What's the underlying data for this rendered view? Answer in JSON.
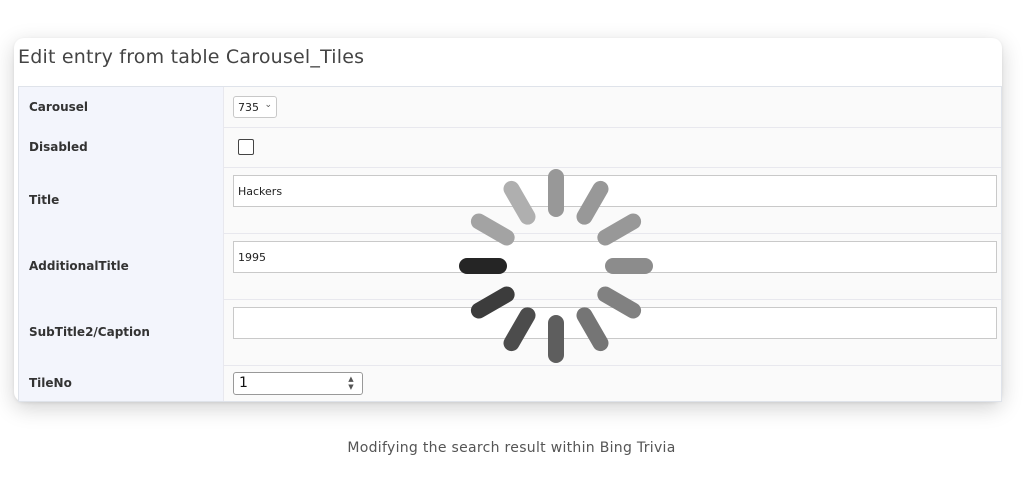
{
  "heading": "Edit entry from table Carousel_Tiles",
  "fields": {
    "carousel": {
      "label": "Carousel",
      "value": "735"
    },
    "disabled": {
      "label": "Disabled",
      "checked": false
    },
    "title": {
      "label": "Title",
      "value": "Hackers"
    },
    "additional_title": {
      "label": "AdditionalTitle",
      "value": "1995"
    },
    "subtitle": {
      "label": "SubTitle2/Caption",
      "value": ""
    },
    "tile_no": {
      "label": "TileNo",
      "value": "1"
    }
  },
  "spinner": {
    "icon": "loading-spinner-icon"
  },
  "caption": "Modifying the search result within Bing Trivia"
}
